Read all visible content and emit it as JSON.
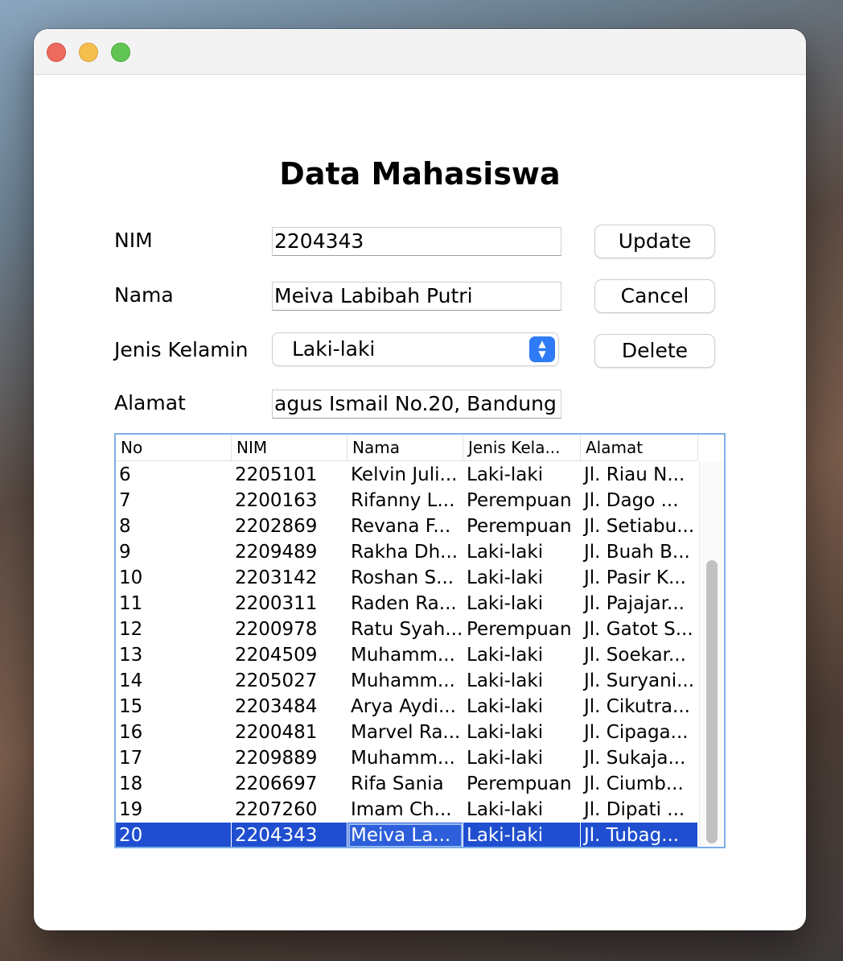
{
  "form": {
    "title": "Data Mahasiswa",
    "nim_label": "NIM",
    "nim_value": "2204343",
    "nama_label": "Nama",
    "nama_value": "Meiva Labibah Putri",
    "jk_label": "Jenis Kelamin",
    "jk_value": "Laki-laki",
    "alamat_label": "Alamat",
    "alamat_value": "agus Ismail No.20, Bandung"
  },
  "buttons": {
    "update": "Update",
    "cancel": "Cancel",
    "delete": "Delete"
  },
  "table": {
    "headers": [
      "No",
      "NIM",
      "Nama",
      "Jenis Kela...",
      "Alamat"
    ],
    "rows": [
      [
        "6",
        "2205101",
        "Kelvin Juli...",
        "Laki-laki",
        "Jl. Riau N..."
      ],
      [
        "7",
        "2200163",
        "Rifanny L...",
        "Perempuan",
        "Jl. Dago ..."
      ],
      [
        "8",
        "2202869",
        "Revana F...",
        "Perempuan",
        "Jl. Setiabu..."
      ],
      [
        "9",
        "2209489",
        "Rakha Dh...",
        "Laki-laki",
        "Jl. Buah B..."
      ],
      [
        "10",
        "2203142",
        "Roshan S...",
        "Laki-laki",
        "Jl. Pasir K..."
      ],
      [
        "11",
        "2200311",
        "Raden Ra...",
        "Laki-laki",
        "Jl. Pajajar..."
      ],
      [
        "12",
        "2200978",
        "Ratu Syah...",
        "Perempuan",
        "Jl. Gatot S..."
      ],
      [
        "13",
        "2204509",
        "Muhamm...",
        "Laki-laki",
        "Jl. Soekar..."
      ],
      [
        "14",
        "2205027",
        "Muhamm...",
        "Laki-laki",
        "Jl. Suryani..."
      ],
      [
        "15",
        "2203484",
        "Arya Aydi...",
        "Laki-laki",
        "Jl. Cikutra..."
      ],
      [
        "16",
        "2200481",
        "Marvel Ra...",
        "Laki-laki",
        "Jl. Cipaga..."
      ],
      [
        "17",
        "2209889",
        "Muhamm...",
        "Laki-laki",
        "Jl. Sukaja..."
      ],
      [
        "18",
        "2206697",
        "Rifa Sania",
        "Perempuan",
        "Jl. Ciumb..."
      ],
      [
        "19",
        "2207260",
        "Imam Ch...",
        "Laki-laki",
        "Jl. Dipati ..."
      ],
      [
        "20",
        "2204343",
        "Meiva La...",
        "Laki-laki",
        "Jl. Tubag..."
      ]
    ],
    "selected_row": "20"
  },
  "colors": {
    "selection": "#1f4fd0",
    "focus_border": "#7eaee6",
    "accent": "#2f7bf5"
  },
  "icons": {
    "select_arrows": "chevron-up-down-icon"
  }
}
